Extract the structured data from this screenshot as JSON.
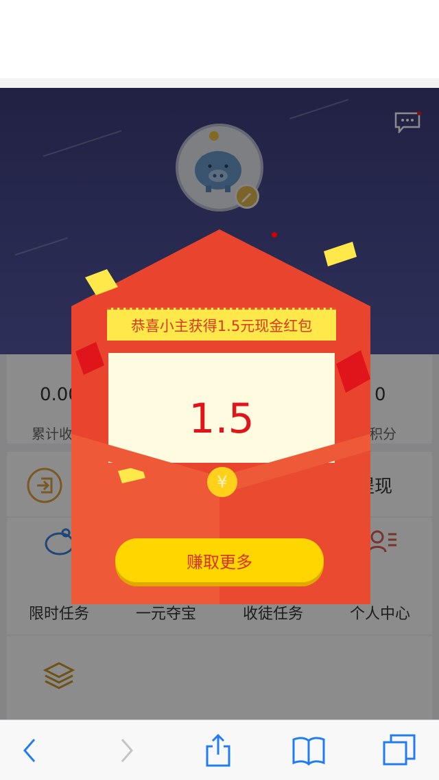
{
  "colors": {
    "accent_red": "#e8442e",
    "gold": "#ffd600",
    "hero_bg": "#3e3d7c",
    "ios_blue": "#1f7cf2"
  },
  "icons": {
    "message": "message-bubble-icon",
    "piggy": "piggy-bank-icon",
    "edit": "pencil-icon",
    "signin": "sign-in-icon",
    "layers": "layers-icon",
    "yen": "yen-coin-icon",
    "back": "chevron-left-icon",
    "forward": "chevron-right-icon",
    "share": "share-icon",
    "bookmarks": "book-icon",
    "tabs": "tabs-icon"
  },
  "stats": [
    {
      "value": "0.00",
      "label": "累计收"
    },
    {
      "value": "0",
      "label": "积分"
    }
  ],
  "withdraw_label": "提现",
  "grid": [
    {
      "label": "限时任务"
    },
    {
      "label": "一元夺宝"
    },
    {
      "label": "收徒任务"
    },
    {
      "label": "个人中心"
    }
  ],
  "modal": {
    "banner": "恭喜小主获得1.5元现金红包",
    "amount": "1.5",
    "coin_symbol": "¥",
    "button": "赚取更多"
  }
}
